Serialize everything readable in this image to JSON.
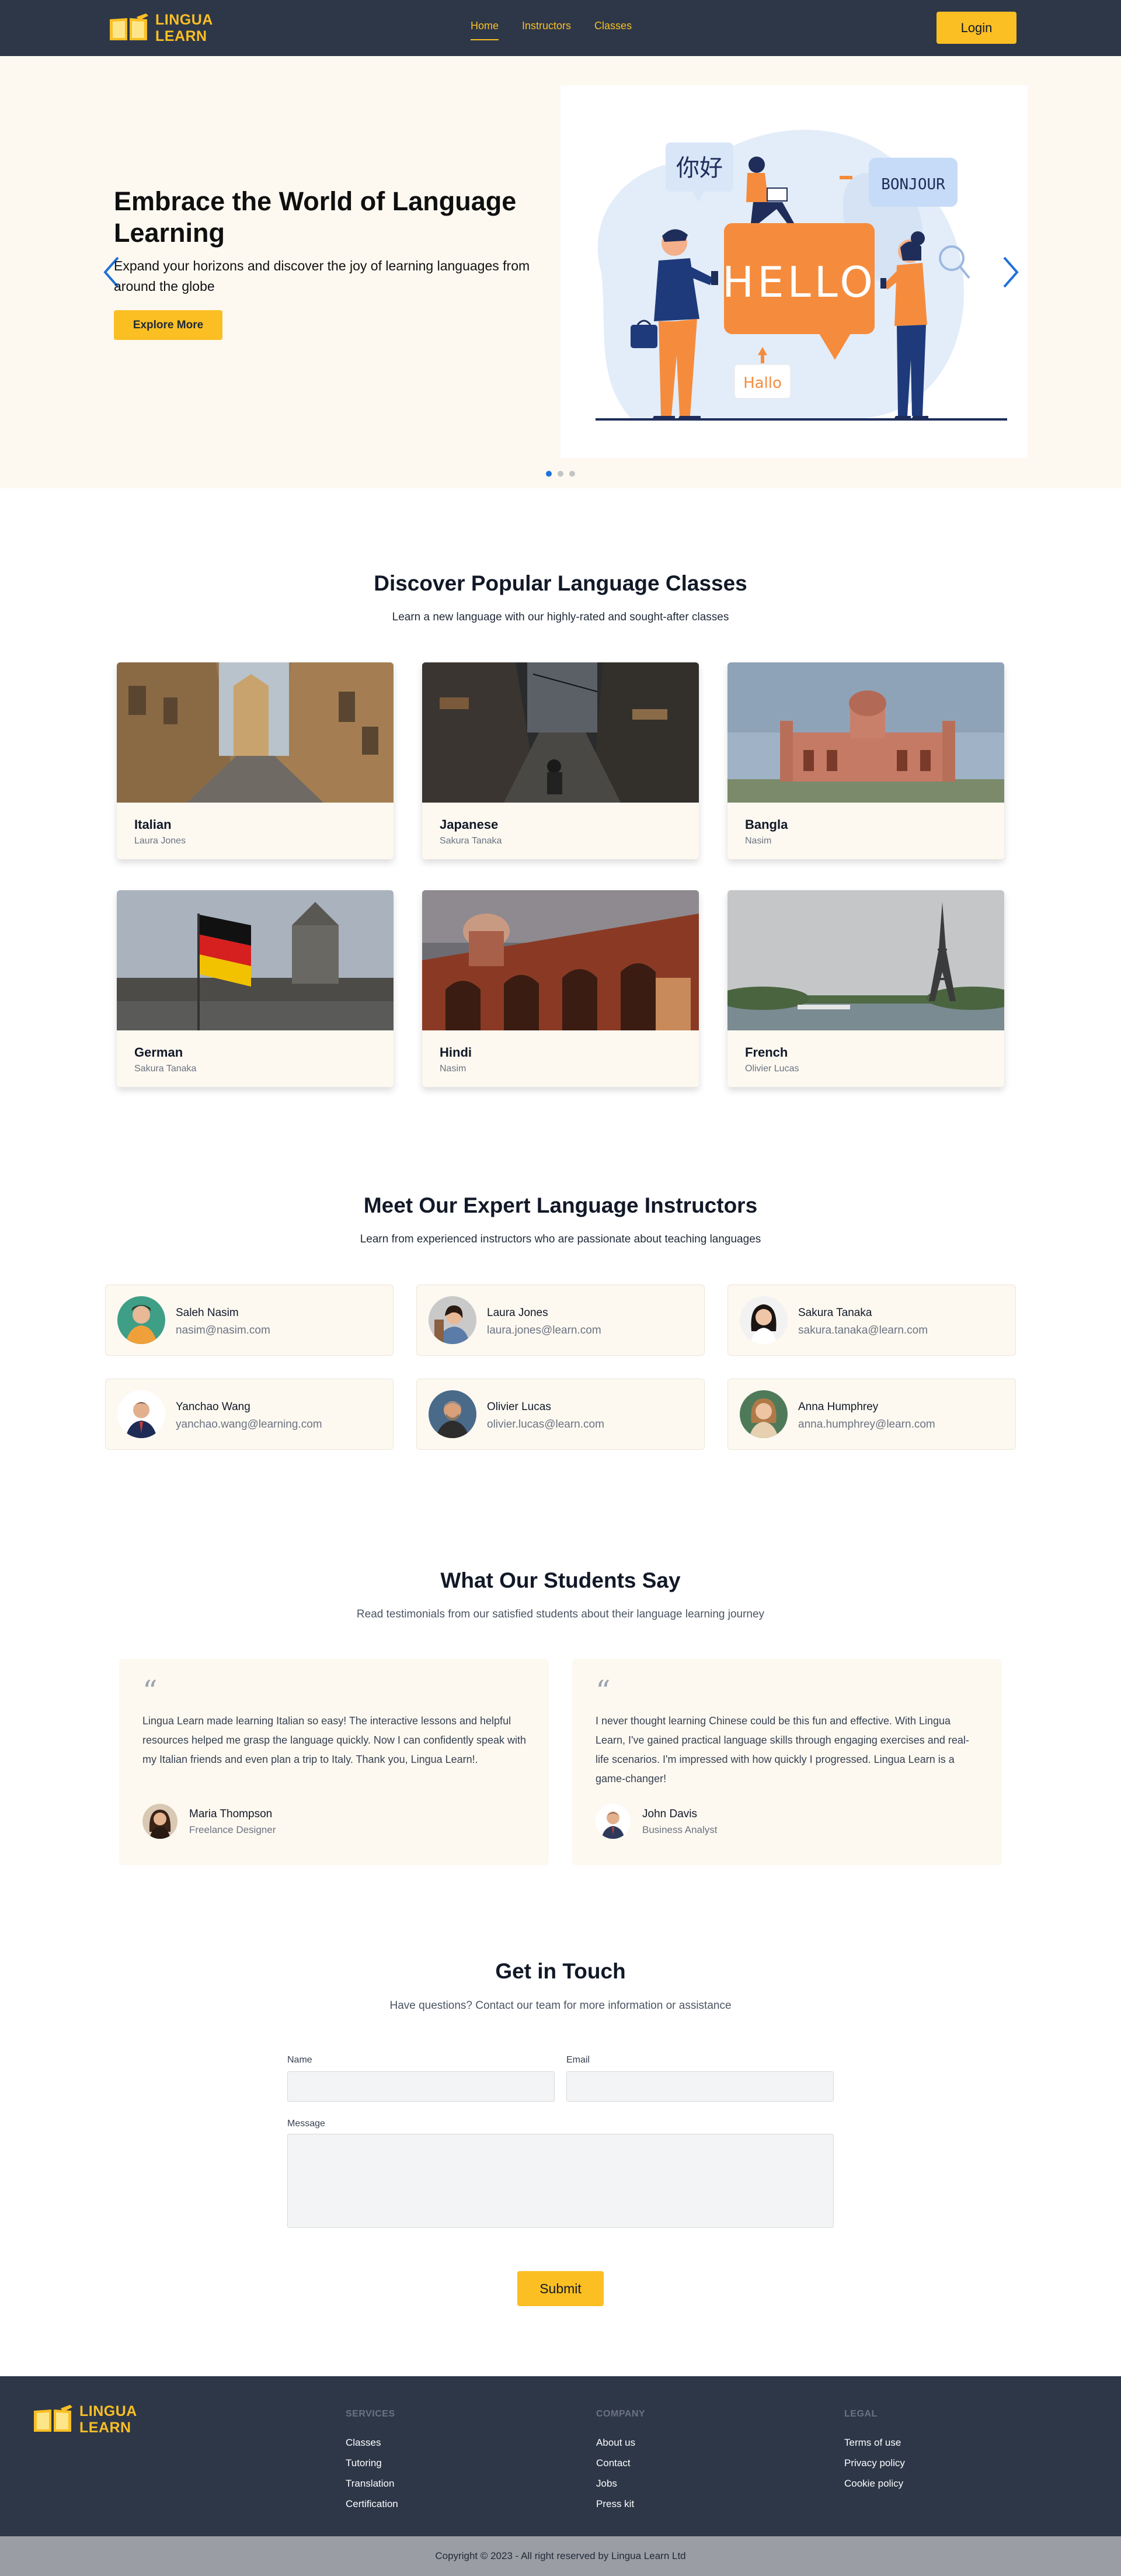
{
  "nav": {
    "logo_line1": "LINGUA",
    "logo_line2": "LEARN",
    "links": [
      "Home",
      "Instructors",
      "Classes"
    ],
    "login_label": "Login"
  },
  "hero": {
    "title": "Embrace the World of Language Learning",
    "subtitle": "Expand your horizons and discover the joy of learning languages from around the globe",
    "cta_label": "Explore More",
    "illustration": {
      "bubble_main": "HELLO",
      "bubble_chinese": "你好",
      "bubble_french": "BONJOUR",
      "bubble_german": "Hallo"
    },
    "slides": 3,
    "active_slide": 1
  },
  "classes": {
    "title": "Discover Popular Language Classes",
    "subtitle": "Learn a new language with our highly-rated and sought-after classes",
    "items": [
      {
        "name": "Italian",
        "instructor": "Laura Jones"
      },
      {
        "name": "Japanese",
        "instructor": "Sakura Tanaka"
      },
      {
        "name": "Bangla",
        "instructor": "Nasim"
      },
      {
        "name": "German",
        "instructor": "Sakura Tanaka"
      },
      {
        "name": "Hindi",
        "instructor": "Nasim"
      },
      {
        "name": "French",
        "instructor": "Olivier Lucas"
      }
    ]
  },
  "instructors": {
    "title": "Meet Our Expert Language Instructors",
    "subtitle": "Learn from experienced instructors who are passionate about teaching languages",
    "items": [
      {
        "name": "Saleh Nasim",
        "email": "nasim@nasim.com"
      },
      {
        "name": "Laura Jones",
        "email": "laura.jones@learn.com"
      },
      {
        "name": "Sakura Tanaka",
        "email": "sakura.tanaka@learn.com"
      },
      {
        "name": "Yanchao Wang",
        "email": "yanchao.wang@learning.com"
      },
      {
        "name": "Olivier Lucas",
        "email": "olivier.lucas@learn.com"
      },
      {
        "name": "Anna Humphrey",
        "email": "anna.humphrey@learn.com"
      }
    ]
  },
  "testimonials": {
    "title": "What Our Students Say",
    "subtitle": "Read testimonials from our satisfied students about their language learning journey",
    "items": [
      {
        "text": "Lingua Learn made learning Italian so easy! The interactive lessons and helpful resources helped me grasp the language quickly. Now I can confidently speak with my Italian friends and even plan a trip to Italy. Thank you, Lingua Learn!.",
        "name": "Maria Thompson",
        "role": "Freelance Designer"
      },
      {
        "text": "I never thought learning Chinese could be this fun and effective. With Lingua Learn, I've gained practical language skills through engaging exercises and real-life scenarios. I'm impressed with how quickly I progressed. Lingua Learn is a game-changer!",
        "name": "John Davis",
        "role": "Business Analyst"
      }
    ]
  },
  "contact": {
    "title": "Get in Touch",
    "subtitle": "Have questions? Contact our team for more information or assistance",
    "name_label": "Name",
    "email_label": "Email",
    "message_label": "Message",
    "name_value": "",
    "email_value": "",
    "message_value": "",
    "submit_label": "Submit"
  },
  "footer": {
    "logo_line1": "LINGUA",
    "logo_line2": "LEARN",
    "columns": [
      {
        "title": "SERVICES",
        "items": [
          "Classes",
          "Tutoring",
          "Translation",
          "Certification"
        ]
      },
      {
        "title": "COMPANY",
        "items": [
          "About us",
          "Contact",
          "Jobs",
          "Press kit"
        ]
      },
      {
        "title": "LEGAL",
        "items": [
          "Terms of use",
          "Privacy policy",
          "Cookie policy"
        ]
      }
    ],
    "copyright": "Copyright © 2023 - All right reserved by Lingua Learn Ltd"
  },
  "colors": {
    "accent": "#fbbf24",
    "dark": "#2d3748",
    "cream": "#fdf9f1",
    "blue": "#1e72d9"
  },
  "icons": [
    "book-logo-icon",
    "chevron-left-icon",
    "chevron-right-icon",
    "quote-icon"
  ]
}
